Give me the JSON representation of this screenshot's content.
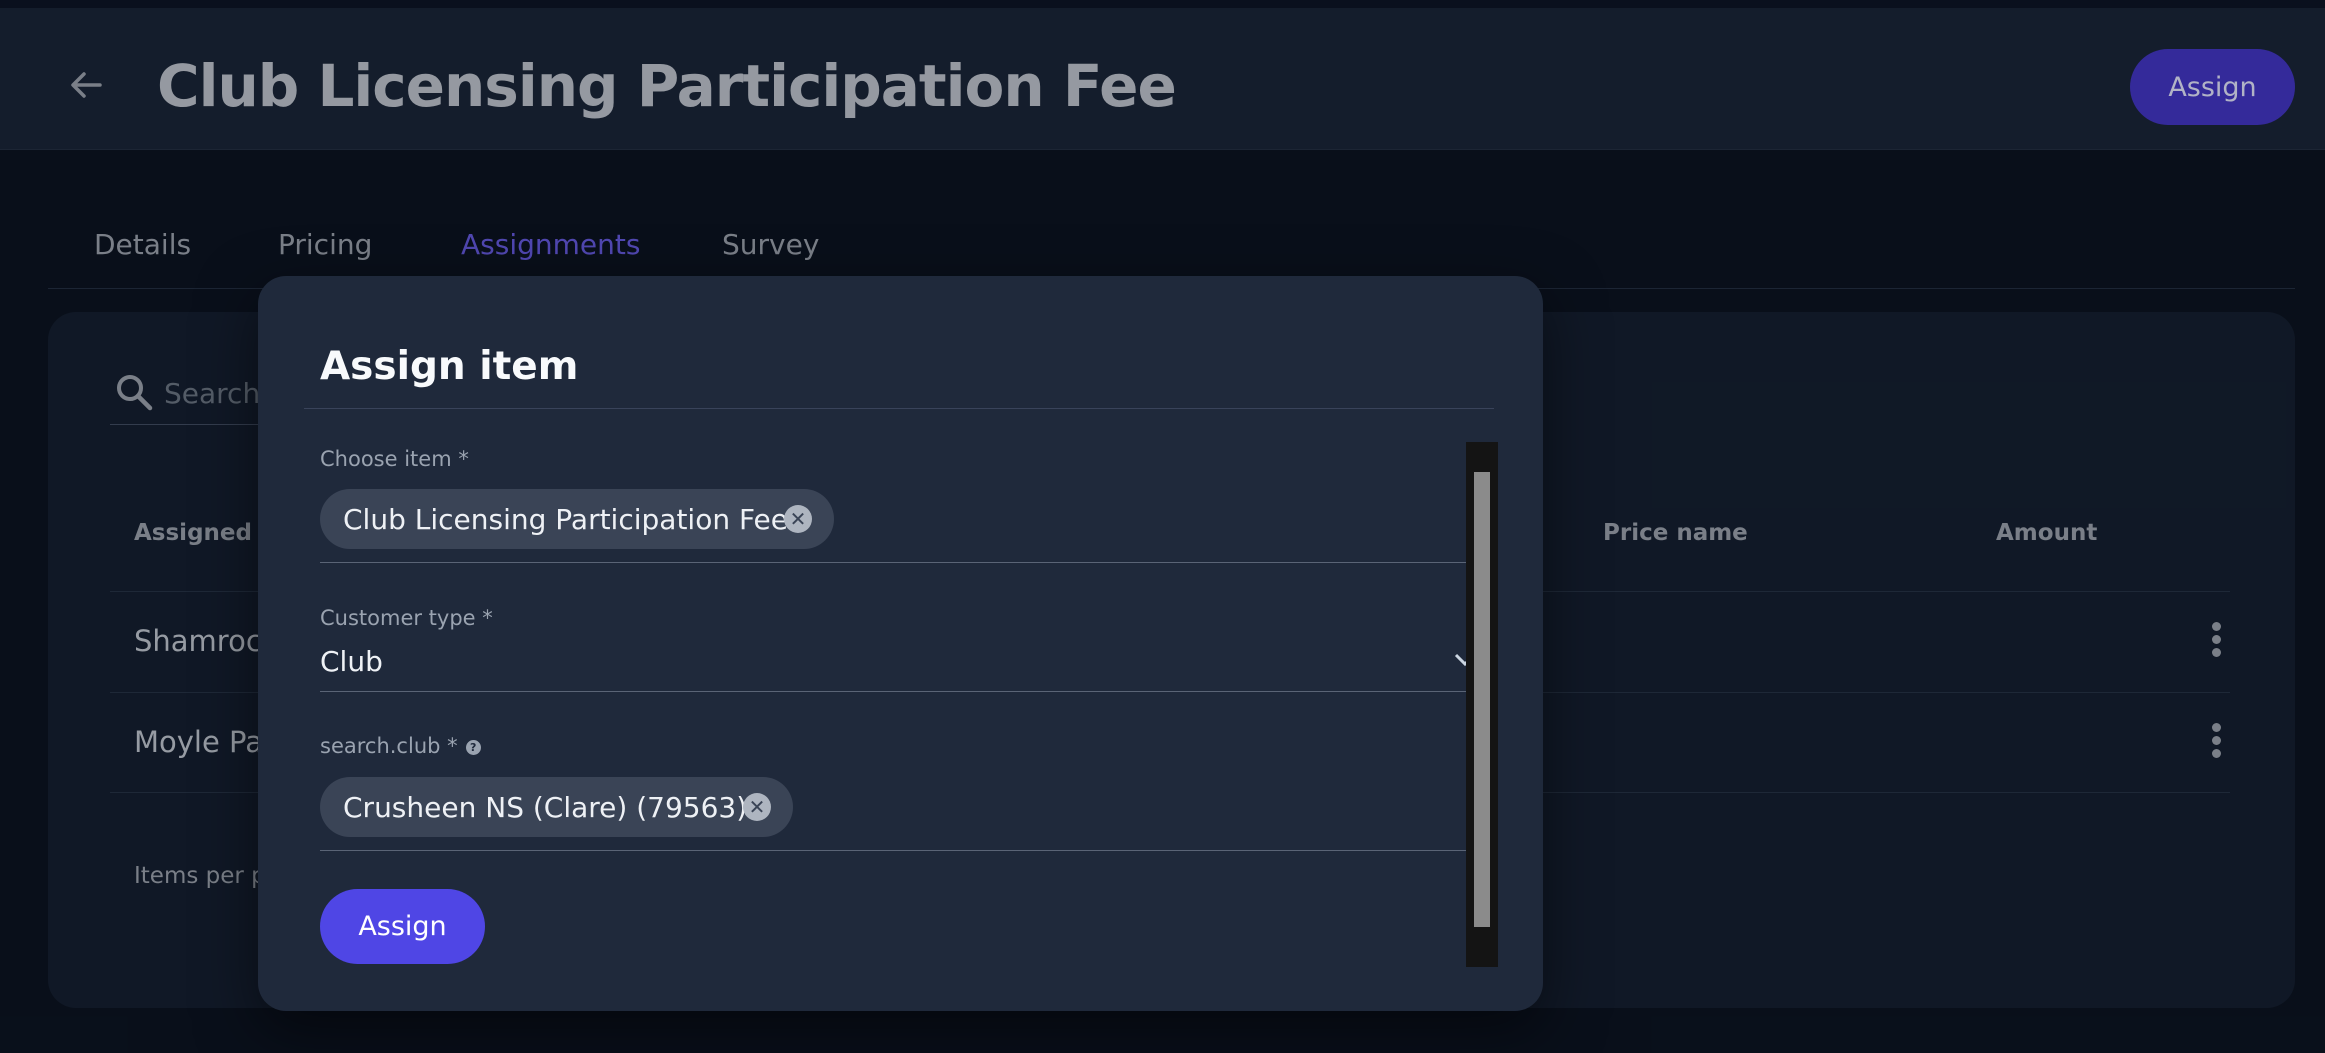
{
  "header": {
    "title": "Club Licensing Participation Fee",
    "assign_label": "Assign"
  },
  "tabs": [
    {
      "label": "Details"
    },
    {
      "label": "Pricing"
    },
    {
      "label": "Assignments",
      "active": true
    },
    {
      "label": "Survey"
    }
  ],
  "table": {
    "search_placeholder": "Search",
    "columns": [
      "Assigned to",
      "Price name",
      "Amount"
    ],
    "rows": [
      {
        "assigned_to": "Shamrock"
      },
      {
        "assigned_to": "Moyle Par"
      }
    ],
    "items_per_page_label": "Items per p"
  },
  "modal": {
    "title": "Assign item",
    "choose_item": {
      "label": "Choose item *",
      "chip": "Club Licensing Participation Fee"
    },
    "customer_type": {
      "label": "Customer type *",
      "value": "Club"
    },
    "search_club": {
      "label": "search.club *",
      "chip": "Crusheen NS (Clare) (79563)"
    },
    "assign_label": "Assign"
  },
  "colors": {
    "accent": "#4f46e5",
    "background": "#0a111c",
    "modal": "#1f293b"
  }
}
